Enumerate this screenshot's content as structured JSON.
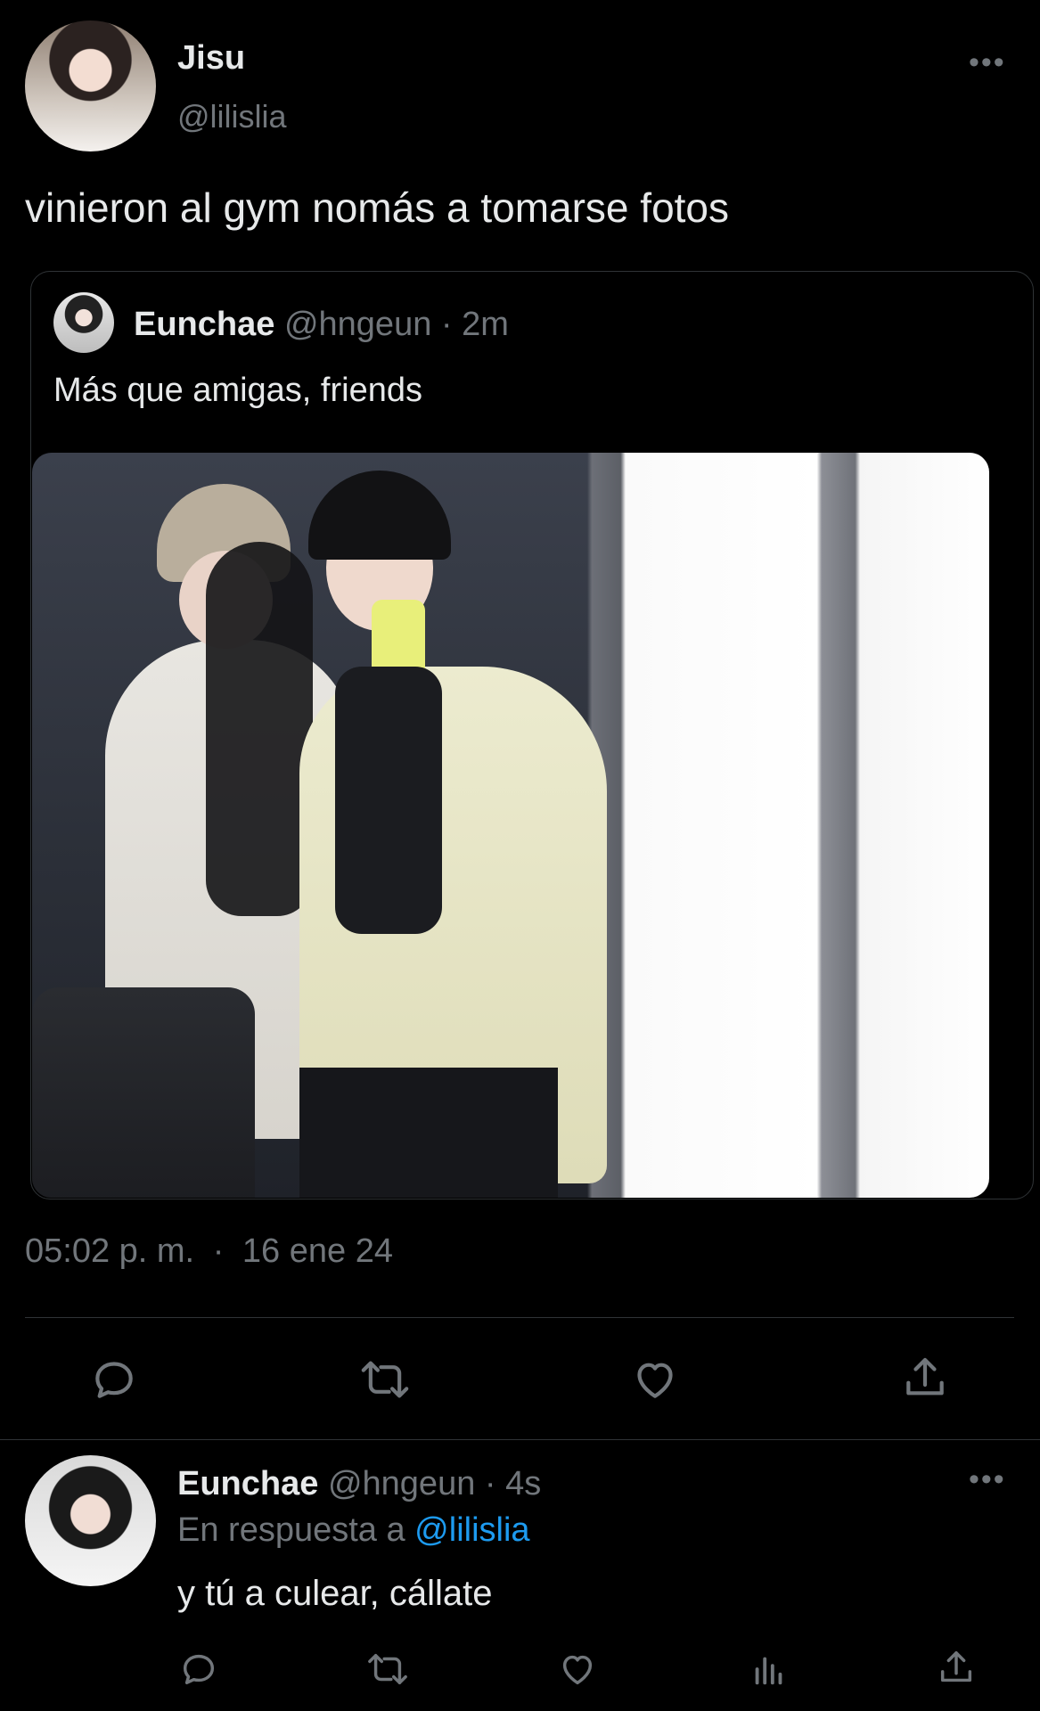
{
  "main_tweet": {
    "author_name": "Jisu",
    "author_handle": "@lilislia",
    "text": "vinieron al gym nomás a tomarse fotos",
    "timestamp": "05:02 p. m.",
    "separator": "·",
    "date": "16 ene 24"
  },
  "quoted_tweet": {
    "author_name": "Eunchae",
    "author_handle": "@hngeun",
    "meta": "· 2m",
    "text": "Más que amigas, friends"
  },
  "reply": {
    "author_name": "Eunchae",
    "author_handle": "@hngeun",
    "meta": "· 4s",
    "in_reply_prefix": "En respuesta a",
    "in_reply_handle": "@lilislia",
    "text": "y tú a culear, cállate"
  },
  "more_menu": "•••",
  "colors": {
    "background": "#000000",
    "text": "#e7e9ea",
    "muted": "#71767b",
    "link": "#1d9bf0",
    "divider": "#2f3336"
  },
  "icons": {
    "main_actions": [
      "reply-icon",
      "retweet-icon",
      "like-icon",
      "share-icon"
    ],
    "reply_actions": [
      "reply-icon",
      "retweet-icon",
      "like-icon",
      "views-icon",
      "share-icon"
    ]
  }
}
